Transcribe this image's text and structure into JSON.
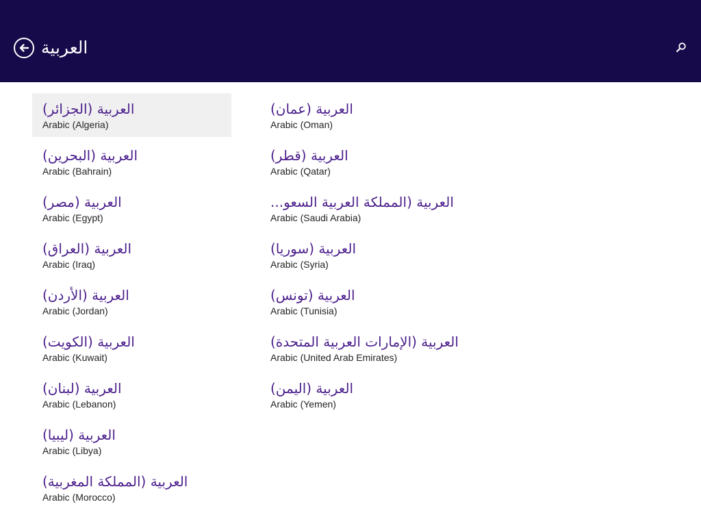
{
  "header": {
    "title": "العربية",
    "back_icon": "back-arrow-circle-icon",
    "search_icon": "search-icon",
    "background": "#170a4a"
  },
  "items": [
    {
      "title": "العربية (الجزائر)",
      "subtitle": "Arabic (Algeria)",
      "selected": true
    },
    {
      "title": "العربية (البحرين)",
      "subtitle": "Arabic (Bahrain)"
    },
    {
      "title": "العربية (مصر)",
      "subtitle": "Arabic (Egypt)"
    },
    {
      "title": "العربية (العراق)",
      "subtitle": "Arabic (Iraq)"
    },
    {
      "title": "العربية (الأردن)",
      "subtitle": "Arabic (Jordan)"
    },
    {
      "title": "العربية (الكويت)",
      "subtitle": "Arabic (Kuwait)"
    },
    {
      "title": "العربية (لبنان)",
      "subtitle": "Arabic (Lebanon)"
    },
    {
      "title": "العربية (ليبيا)",
      "subtitle": "Arabic (Libya)"
    },
    {
      "title": "العربية (المملكة المغربية)",
      "subtitle": "Arabic (Morocco)"
    },
    {
      "title": "العربية (عمان)",
      "subtitle": "Arabic (Oman)"
    },
    {
      "title": "العربية (قطر)",
      "subtitle": "Arabic (Qatar)"
    },
    {
      "title": "العربية (المملكة العربية السعو...",
      "subtitle": "Arabic (Saudi Arabia)"
    },
    {
      "title": "العربية (سوريا)",
      "subtitle": "Arabic (Syria)"
    },
    {
      "title": "العربية (تونس)",
      "subtitle": "Arabic (Tunisia)"
    },
    {
      "title": "العربية (الإمارات العربية المتحدة)",
      "subtitle": "Arabic (United Arab Emirates)"
    },
    {
      "title": "العربية (اليمن)",
      "subtitle": "Arabic (Yemen)"
    }
  ],
  "colors": {
    "accent": "#4b1f8c",
    "selected_bg": "#f0f0f0"
  }
}
